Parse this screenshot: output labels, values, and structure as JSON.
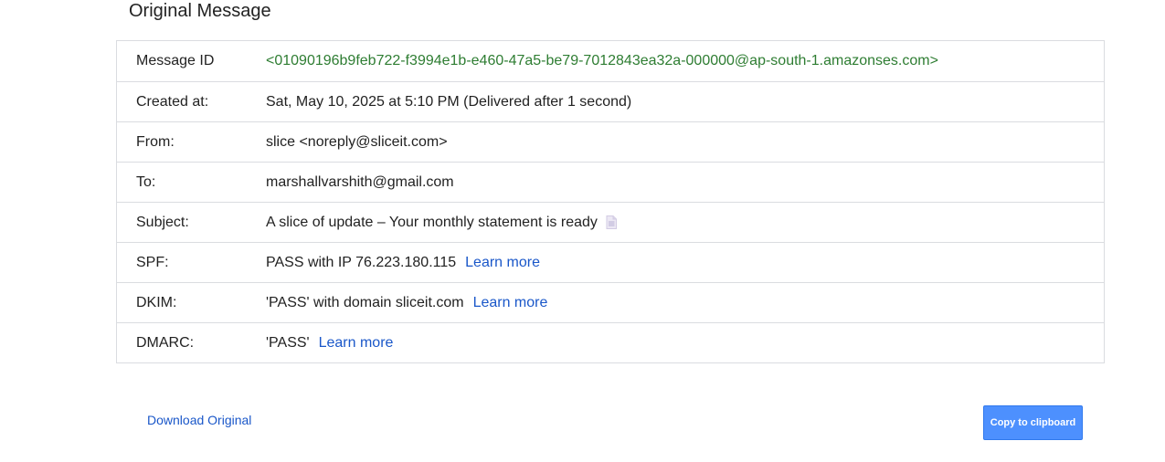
{
  "page": {
    "title": "Original Message"
  },
  "details": [
    {
      "label": "Message ID",
      "value": "<01090196b9feb722-f3994e1b-e460-47a5-be79-7012843ea32a-000000@ap-south-1.amazonses.com>"
    },
    {
      "label": "Created at:",
      "value": "Sat, May 10, 2025 at 5:10 PM (Delivered after 1 second)"
    },
    {
      "label": "From:",
      "value": "slice <noreply@sliceit.com>"
    },
    {
      "label": "To:",
      "value": "marshallvarshith@gmail.com"
    },
    {
      "label": "Subject:",
      "value": "A slice of update – Your monthly statement is ready"
    },
    {
      "label": "SPF:",
      "value": "PASS with IP 76.223.180.115",
      "link": "Learn more"
    },
    {
      "label": "DKIM:",
      "value": "'PASS' with domain sliceit.com",
      "link": "Learn more"
    },
    {
      "label": "DMARC:",
      "value": "'PASS'",
      "link": "Learn more"
    }
  ],
  "footer": {
    "download_label": "Download Original",
    "copy_label": "Copy to clipboard"
  },
  "colors": {
    "message_id": "#2e7d32",
    "link": "#1a57c9",
    "button": "#4d90fe"
  },
  "icons": {
    "subject_icon": "document-icon"
  }
}
